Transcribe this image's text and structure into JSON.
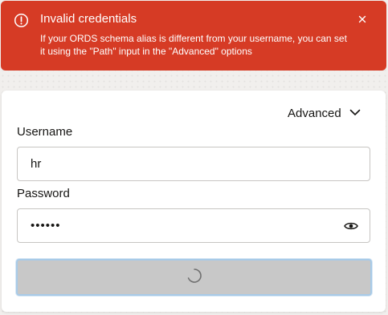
{
  "alert": {
    "title": "Invalid credentials",
    "message": "If your ORDS schema alias is different from your username, you can set it using the \"Path\" input in the \"Advanced\" options",
    "icon": "alert-circle-icon",
    "close_icon": "close-icon",
    "color": "#d63b25"
  },
  "form": {
    "advanced_label": "Advanced",
    "username_label": "Username",
    "username_value": "hr",
    "password_label": "Password",
    "password_value": "secret",
    "show_password_icon": "eye-icon",
    "submit_state": "loading",
    "submit_icon": "spinner-icon"
  }
}
